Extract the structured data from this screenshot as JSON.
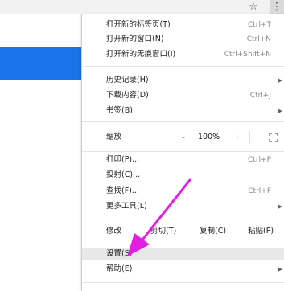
{
  "toolbar": {
    "star_icon": "star-icon",
    "menu_icon": "kebab-icon"
  },
  "colors": {
    "blue_block": "#1a73e8",
    "annotation_arrow": "#e21ee0"
  },
  "menu": {
    "new_tab": {
      "label": "打开新的标签页(T)",
      "shortcut": "Ctrl+T"
    },
    "new_window": {
      "label": "打开新的窗口(N)",
      "shortcut": "Ctrl+N"
    },
    "incognito": {
      "label": "打开新的无痕窗口(I)",
      "shortcut": "Ctrl+Shift+N"
    },
    "history": {
      "label": "历史记录(H)"
    },
    "downloads": {
      "label": "下载内容(D)",
      "shortcut": "Ctrl+J"
    },
    "bookmarks": {
      "label": "书签(B)"
    },
    "zoom": {
      "label": "缩放",
      "minus": "-",
      "value": "100%",
      "plus": "+"
    },
    "print": {
      "label": "打印(P)...",
      "shortcut": "Ctrl+P"
    },
    "cast": {
      "label": "投射(C)..."
    },
    "find": {
      "label": "查找(F)...",
      "shortcut": "Ctrl+F"
    },
    "more_tools": {
      "label": "更多工具(L)"
    },
    "edit": {
      "label": "修改",
      "cut": "剪切(T)",
      "copy": "复制(C)",
      "paste": "粘贴(P)"
    },
    "settings": {
      "label": "设置(S)"
    },
    "help": {
      "label": "帮助(E)"
    }
  }
}
